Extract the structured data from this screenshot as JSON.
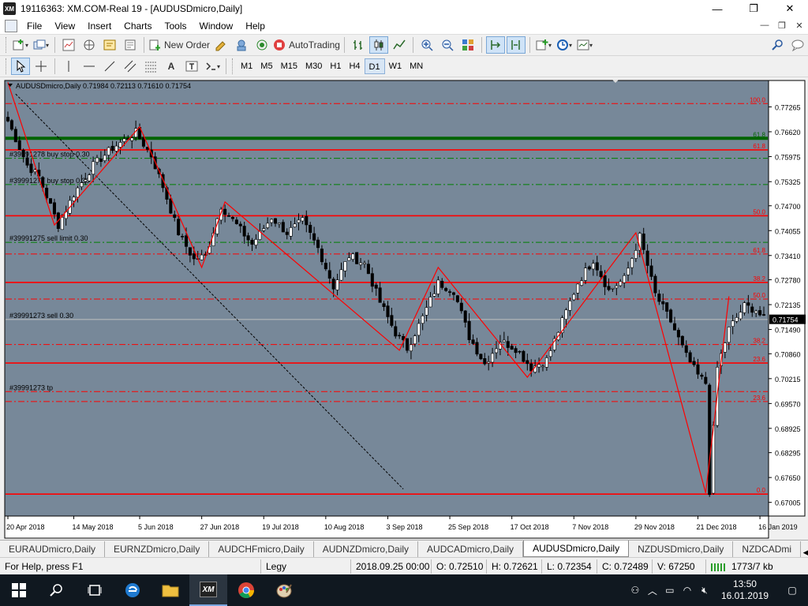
{
  "window": {
    "title": "19116363: XM.COM-Real 19 - [AUDUSDmicro,Daily]",
    "logo": "XM",
    "minimize": "—",
    "restore": "❐",
    "close": "✕"
  },
  "menu": {
    "items": [
      "File",
      "View",
      "Insert",
      "Charts",
      "Tools",
      "Window",
      "Help"
    ],
    "mdi": [
      "—",
      "❐",
      "✕"
    ]
  },
  "toolbar1": {
    "new_order": "New Order",
    "autotrading": "AutoTrading"
  },
  "toolbar2": {
    "timeframes": [
      "M1",
      "M5",
      "M15",
      "M30",
      "H1",
      "H4",
      "D1",
      "W1",
      "MN"
    ],
    "active_timeframe": "D1"
  },
  "chart_data": {
    "type": "candlestick",
    "symbol_header": "AUDUSDmicro,Daily  0.71984 0.72113 0.71610 0.71754",
    "current_price": 0.71754,
    "ylim": [
      0.6665,
      0.7795
    ],
    "y_ticks": [
      0.77265,
      0.7662,
      0.75975,
      0.75325,
      0.747,
      0.74055,
      0.7341,
      0.7278,
      0.72135,
      0.7149,
      0.7086,
      0.70215,
      0.6957,
      0.68925,
      0.68295,
      0.6765,
      0.67005
    ],
    "y_tick_labels": [
      "0.77265",
      "0.76620",
      "0.75975",
      "0.75325",
      "0.74700",
      "0.74055",
      "0.73410",
      "0.72780",
      "0.72135",
      "0.71490",
      "0.70860",
      "0.70215",
      "0.69570",
      "0.68925",
      "0.68295",
      "0.67650",
      "0.67005"
    ],
    "x_tick_labels": [
      "20 Apr 2018",
      "14 May 2018",
      "5 Jun 2018",
      "27 Jun 2018",
      "19 Jul 2018",
      "10 Aug 2018",
      "3 Sep 2018",
      "25 Sep 2018",
      "17 Oct 2018",
      "7 Nov 2018",
      "29 Nov 2018",
      "21 Dec 2018",
      "16 Jan 2019"
    ],
    "x_tick_positions": [
      0,
      17,
      34,
      50,
      66,
      82,
      98,
      114,
      130,
      146,
      162,
      178,
      194
    ],
    "n_bars": 196,
    "close_path": [
      [
        0,
        0.769
      ],
      [
        5,
        0.7575
      ],
      [
        8,
        0.7545
      ],
      [
        13,
        0.742
      ],
      [
        17,
        0.75
      ],
      [
        22,
        0.7575
      ],
      [
        27,
        0.762
      ],
      [
        33,
        0.766
      ],
      [
        37,
        0.76
      ],
      [
        40,
        0.752
      ],
      [
        44,
        0.74
      ],
      [
        48,
        0.733
      ],
      [
        51,
        0.734
      ],
      [
        55,
        0.747
      ],
      [
        59,
        0.742
      ],
      [
        63,
        0.737
      ],
      [
        68,
        0.744
      ],
      [
        72,
        0.74
      ],
      [
        76,
        0.743
      ],
      [
        80,
        0.736
      ],
      [
        84,
        0.726
      ],
      [
        88,
        0.734
      ],
      [
        92,
        0.732
      ],
      [
        96,
        0.722
      ],
      [
        100,
        0.714
      ],
      [
        103,
        0.71
      ],
      [
        107,
        0.718
      ],
      [
        111,
        0.727
      ],
      [
        115,
        0.725
      ],
      [
        119,
        0.713
      ],
      [
        123,
        0.706
      ],
      [
        127,
        0.712
      ],
      [
        131,
        0.71
      ],
      [
        135,
        0.705
      ],
      [
        139,
        0.707
      ],
      [
        143,
        0.717
      ],
      [
        147,
        0.727
      ],
      [
        151,
        0.733
      ],
      [
        155,
        0.725
      ],
      [
        159,
        0.728
      ],
      [
        163,
        0.739
      ],
      [
        167,
        0.724
      ],
      [
        171,
        0.717
      ],
      [
        175,
        0.708
      ],
      [
        178,
        0.703
      ],
      [
        180,
        0.701
      ],
      [
        181,
        0.673
      ],
      [
        183,
        0.705
      ],
      [
        186,
        0.715
      ],
      [
        190,
        0.721
      ],
      [
        193,
        0.72
      ],
      [
        195,
        0.7175
      ]
    ],
    "zigzag": [
      [
        0,
        0.779
      ],
      [
        12,
        0.742
      ],
      [
        34,
        0.7675
      ],
      [
        50,
        0.731
      ],
      [
        56,
        0.748
      ],
      [
        101,
        0.7095
      ],
      [
        111,
        0.731
      ],
      [
        134,
        0.7025
      ],
      [
        162,
        0.74
      ],
      [
        180,
        0.6725
      ],
      [
        186,
        0.7235
      ]
    ],
    "trendline": [
      [
        2,
        0.776
      ],
      [
        102,
        0.6735
      ]
    ],
    "horizontal_lines": [
      {
        "price": 0.7735,
        "style": "dashdot",
        "color": "#ff0000",
        "label": "100.0"
      },
      {
        "price": 0.7645,
        "style": "solid",
        "color": "#006400",
        "label": "61.8"
      },
      {
        "price": 0.7615,
        "style": "solid",
        "color": "#ff0000",
        "label": "61.8"
      },
      {
        "price": 0.7593,
        "style": "dashdot",
        "color": "#008000",
        "label": ""
      },
      {
        "price": 0.7525,
        "style": "dashdot",
        "color": "#008000",
        "label": ""
      },
      {
        "price": 0.7444,
        "style": "solid",
        "color": "#ff0000",
        "label": "50.0"
      },
      {
        "price": 0.7375,
        "style": "dashdot",
        "color": "#008000",
        "label": ""
      },
      {
        "price": 0.7345,
        "style": "dashdot",
        "color": "#ff0000",
        "label": "61.8"
      },
      {
        "price": 0.7271,
        "style": "solid",
        "color": "#ff0000",
        "label": "38.2"
      },
      {
        "price": 0.7228,
        "style": "dashdot",
        "color": "#ff0000",
        "label": "50.0"
      },
      {
        "price": 0.7175,
        "style": "solid",
        "color": "#c0c0c0",
        "label": ""
      },
      {
        "price": 0.711,
        "style": "dashdot",
        "color": "#ff0000",
        "label": "38.2"
      },
      {
        "price": 0.7062,
        "style": "solid",
        "color": "#ff0000",
        "label": "23.6"
      },
      {
        "price": 0.6988,
        "style": "dashdot",
        "color": "#ff0000",
        "label": ""
      },
      {
        "price": 0.6962,
        "style": "dashdot",
        "color": "#ff0000",
        "label": "23.6"
      },
      {
        "price": 0.6722,
        "style": "solid",
        "color": "#ff0000",
        "label": "0.0"
      }
    ],
    "order_labels": [
      {
        "price": 0.7597,
        "text": "#39991278 buy stop 0.30"
      },
      {
        "price": 0.7529,
        "text": "#39991277 buy stop 0.30"
      },
      {
        "price": 0.7379,
        "text": "#39991275 sell limit 0.30"
      },
      {
        "price": 0.7179,
        "text": "#39991273 sell 0.30"
      },
      {
        "price": 0.6992,
        "text": "#39991273 tp"
      }
    ],
    "colors": {
      "background": "#778899",
      "candle": "#000000",
      "axis_text": "#000000",
      "price_tag_bg": "#000000",
      "price_tag_fg": "#ffffff"
    }
  },
  "tabs": {
    "items": [
      "EURAUDmicro,Daily",
      "EURNZDmicro,Daily",
      "AUDCHFmicro,Daily",
      "AUDNZDmicro,Daily",
      "AUDCADmicro,Daily",
      "AUDUSDmicro,Daily",
      "NZDUSDmicro,Daily",
      "NZDCADmi"
    ],
    "active_index": 5
  },
  "status": {
    "help": "For Help, press F1",
    "profile": "Legy",
    "time": "2018.09.25 00:00",
    "open": "O: 0.72510",
    "high": "H: 0.72621",
    "low": "L: 0.72354",
    "close": "C: 0.72489",
    "volume": "V: 67250",
    "traffic": "1773/7 kb"
  },
  "taskbar": {
    "time": "13:50",
    "date": "16.01.2019",
    "xm_label": "XM"
  }
}
